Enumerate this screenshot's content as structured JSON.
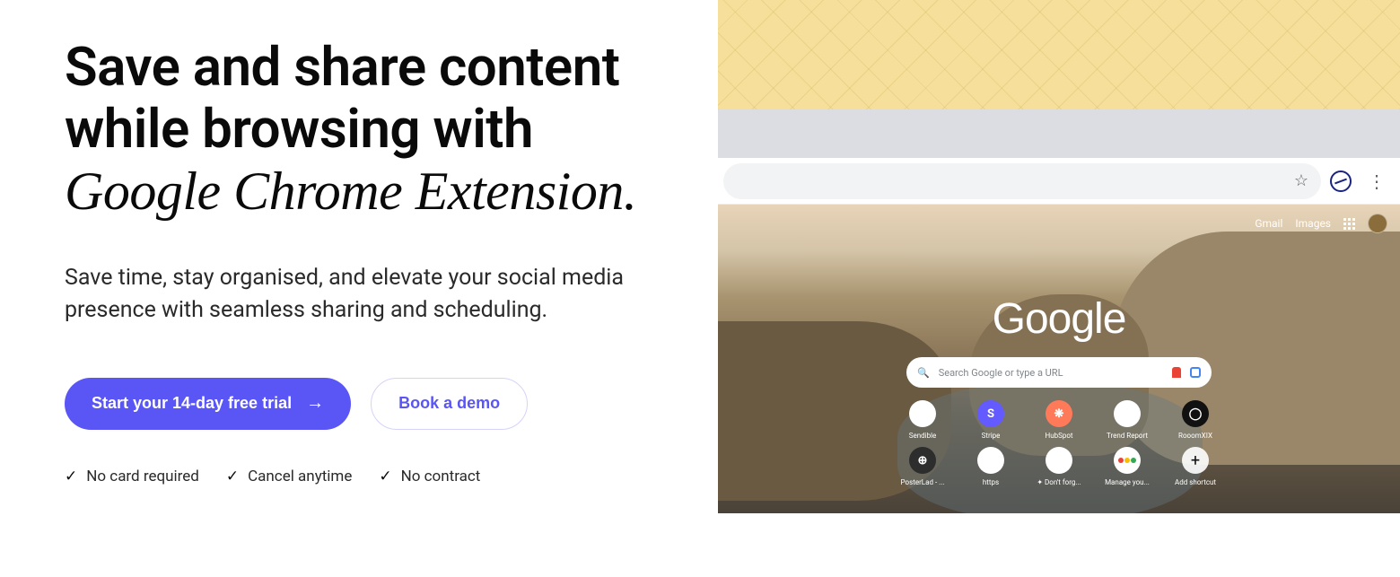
{
  "hero": {
    "headline_line1": "Save and share content",
    "headline_line2": "while browsing with",
    "headline_italic": "Google Chrome Extension",
    "headline_period": ".",
    "subtext": "Save time, stay organised, and elevate your social media presence with seamless sharing and scheduling."
  },
  "cta": {
    "primary": "Start your 14-day free trial",
    "secondary": "Book a demo"
  },
  "features": [
    "No card required",
    "Cancel anytime",
    "No contract"
  ],
  "browser": {
    "top_links": {
      "gmail": "Gmail",
      "images": "Images"
    },
    "logo": "Google",
    "search_placeholder": "Search Google or type a URL",
    "shortcuts_row1": [
      {
        "label": "Sendible",
        "iconClass": "ico-white",
        "glyph": ""
      },
      {
        "label": "Stripe",
        "iconClass": "ico-blue",
        "glyph": "S"
      },
      {
        "label": "HubSpot",
        "iconClass": "ico-orange",
        "glyph": "❋"
      },
      {
        "label": "Trend Report",
        "iconClass": "ico-white",
        "glyph": ""
      },
      {
        "label": "RooomXIX",
        "iconClass": "ico-black",
        "glyph": "◯"
      }
    ],
    "shortcuts_row2": [
      {
        "label": "PosterLad - ...",
        "iconClass": "ico-dark",
        "glyph": "⊕"
      },
      {
        "label": "https",
        "iconClass": "ico-white",
        "glyph": ""
      },
      {
        "label": "✦ Don't forg...",
        "iconClass": "ico-white",
        "glyph": ""
      },
      {
        "label": "Manage you...",
        "iconClass": "ico-circles",
        "glyph": ""
      },
      {
        "label": "Add shortcut",
        "iconClass": "plus-ico",
        "glyph": "+"
      }
    ]
  }
}
